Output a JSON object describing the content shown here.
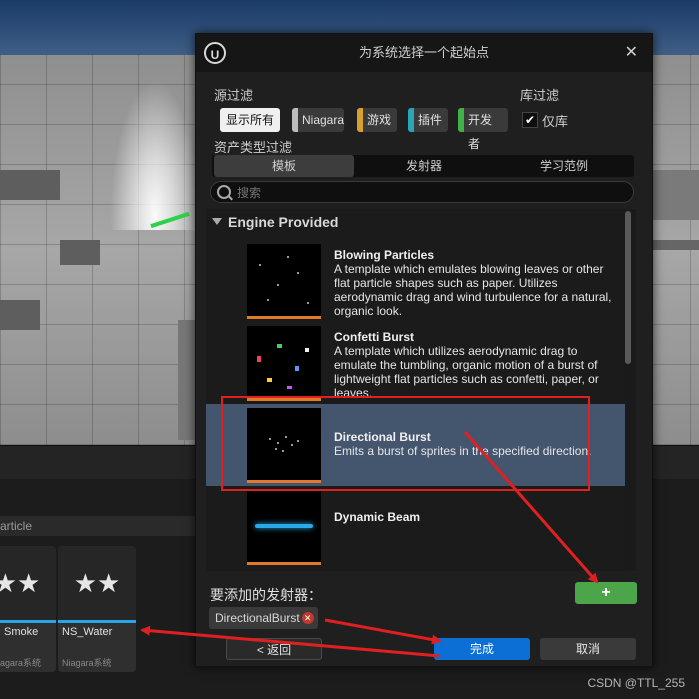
{
  "background": {
    "content_browser_strip": "article",
    "assets": [
      {
        "name": "Smoke",
        "type": "agara系统"
      },
      {
        "name": "NS_Water",
        "type": "Niagara系统"
      }
    ]
  },
  "dialog": {
    "title": "为系统选择一个起始点",
    "source_filter_label": "源过滤",
    "library_filter_label": "库过滤",
    "source_chips": [
      {
        "label": "显示所有",
        "color": "#f0f0f0"
      },
      {
        "label": "Niagara",
        "color": "#bdbdbd"
      },
      {
        "label": "游戏",
        "color": "#d8a02c"
      },
      {
        "label": "插件",
        "color": "#2aa6b8"
      },
      {
        "label": "开发者",
        "color": "#3fb34a"
      }
    ],
    "library_checkbox_label": "仅库",
    "library_checked": true,
    "asset_type_label": "资产类型过滤",
    "tabs": [
      {
        "label": "模板",
        "active": true
      },
      {
        "label": "发射器",
        "active": false
      },
      {
        "label": "学习范例",
        "active": false
      }
    ],
    "search_placeholder": "搜索",
    "category": "Engine Provided",
    "items": [
      {
        "name": "Blowing Particles",
        "desc": "A template which emulates blowing leaves or other flat particle shapes such as paper. Utilizes aerodynamic drag and wind turbulence for a natural, organic look.",
        "selected": false
      },
      {
        "name": "Confetti Burst",
        "desc": "A template which utilizes aerodynamic drag to emulate the tumbling, organic motion of a burst of lightweight flat particles such as confetti, paper, or leaves.",
        "selected": false
      },
      {
        "name": "Directional Burst",
        "desc": "Emits a burst of sprites in the specified direction.",
        "selected": true
      },
      {
        "name": "Dynamic Beam",
        "desc": "",
        "selected": false
      }
    ],
    "add_emitters_label": "要添加的发射器：",
    "add_button": "+",
    "selected_emitter": "DirectionalBurst",
    "back_button": "< 返回",
    "done_button": "完成",
    "cancel_button": "取消"
  },
  "watermark": "CSDN @TTL_255",
  "colors": {
    "accent_blue": "#0b6fd6",
    "add_green": "#4da54a",
    "annotation_red": "#e02020",
    "selected_row": "#44556e"
  }
}
